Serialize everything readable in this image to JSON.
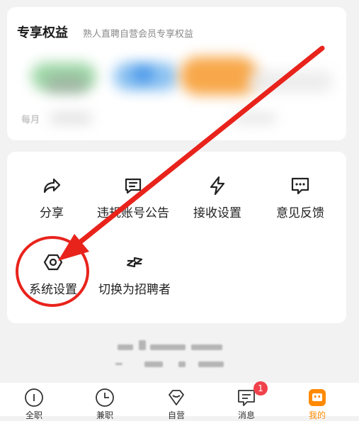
{
  "benefits": {
    "title": "专享权益",
    "subtitle": "熟人直聘自营会员专享权益",
    "monthly_text": "每月"
  },
  "tools": [
    {
      "label": "分享"
    },
    {
      "label": "违规账号公告"
    },
    {
      "label": "接收设置"
    },
    {
      "label": "意见反馈"
    },
    {
      "label": "系统设置"
    },
    {
      "label": "切换为招聘者"
    }
  ],
  "tabbar": {
    "tabs": [
      {
        "label": "全职"
      },
      {
        "label": "兼职"
      },
      {
        "label": "自营"
      },
      {
        "label": "消息"
      },
      {
        "label": "我的"
      }
    ],
    "message_badge": "1"
  },
  "colors": {
    "accent": "#ff8a00",
    "annotation_red": "#e8231c",
    "badge_red": "#f0414a"
  }
}
